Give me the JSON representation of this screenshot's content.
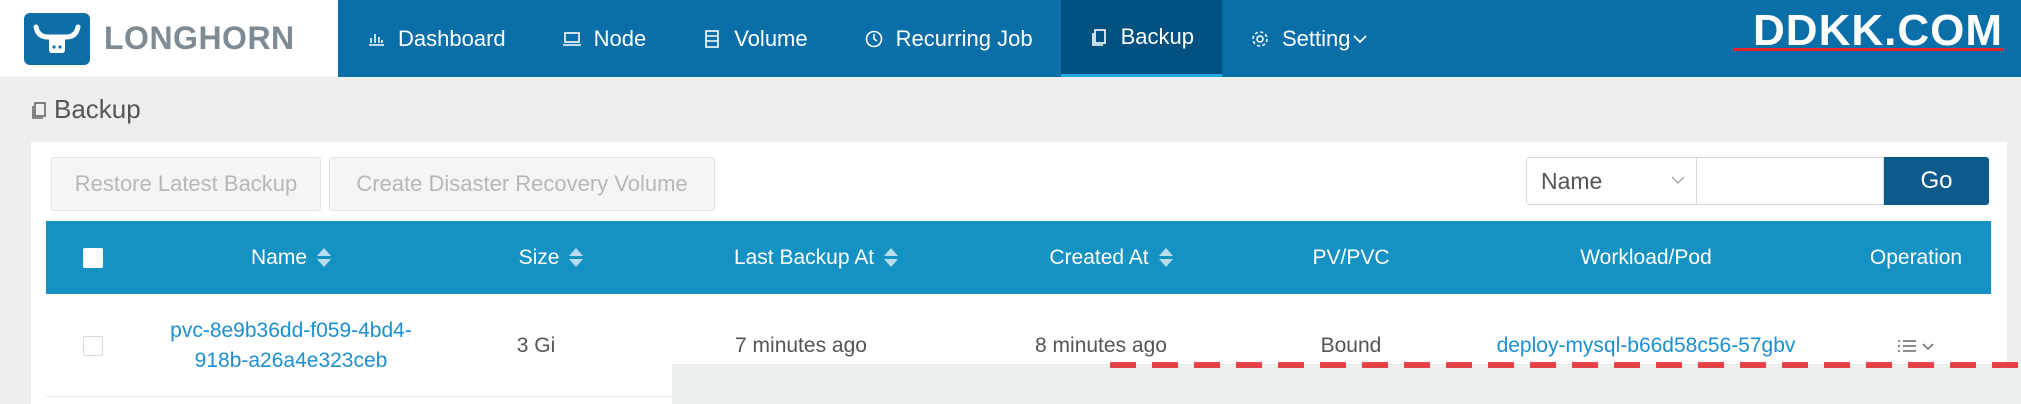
{
  "app": {
    "brand": "LONGHORN",
    "watermark": "DDKK.COM"
  },
  "nav": {
    "items": [
      {
        "label": "Dashboard",
        "icon": "bar-chart-icon"
      },
      {
        "label": "Node",
        "icon": "laptop-icon"
      },
      {
        "label": "Volume",
        "icon": "database-icon"
      },
      {
        "label": "Recurring Job",
        "icon": "clock-icon"
      },
      {
        "label": "Backup",
        "icon": "copy-icon",
        "active": true
      },
      {
        "label": "Setting",
        "icon": "gear-icon"
      }
    ]
  },
  "page": {
    "title": "Backup"
  },
  "toolbar": {
    "restore_label": "Restore Latest Backup",
    "drv_label": "Create Disaster Recovery Volume",
    "filter_selected": "Name",
    "search_value": "",
    "go_label": "Go"
  },
  "table": {
    "columns": [
      "Name",
      "Size",
      "Last Backup At",
      "Created At",
      "PV/PVC",
      "Workload/Pod",
      "Operation"
    ],
    "rows": [
      {
        "name_line1": "pvc-8e9b36dd-f059-4bd4-",
        "name_line2": "918b-a26a4e323ceb",
        "size": "3 Gi",
        "last_backup_at": "7 minutes ago",
        "created_at": "8 minutes ago",
        "pv_pvc": "Bound",
        "workload_pod": "deploy-mysql-b66d58c56-57gbv",
        "operation_icon": "list-menu-icon"
      }
    ]
  },
  "colors": {
    "nav_bg": "#0a6fa8",
    "nav_active": "#005180",
    "table_header": "#1592c4",
    "go_button": "#0e5a8a",
    "link": "#1b8fd0"
  }
}
